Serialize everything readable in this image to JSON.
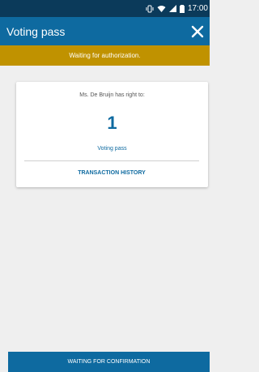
{
  "status_bar": {
    "time": "17:00",
    "icons": [
      "vibrate-icon",
      "wifi-icon",
      "signal-icon",
      "battery-icon"
    ]
  },
  "app_bar": {
    "title": "Voting pass",
    "close_icon": "close-icon"
  },
  "banner": {
    "text": "Waiting for authorization."
  },
  "card": {
    "entitlement_text": "Ms. De  Bruijn has right to:",
    "count": "1",
    "item_label": "Voting pass",
    "history_button": "TRANSACTION HISTORY"
  },
  "footer": {
    "button_label": "WAITING FOR CONFIRMATION"
  },
  "colors": {
    "primary": "#0e6aa0",
    "status_bar": "#0b3a5a",
    "banner": "#c09200",
    "background": "#efefef"
  }
}
